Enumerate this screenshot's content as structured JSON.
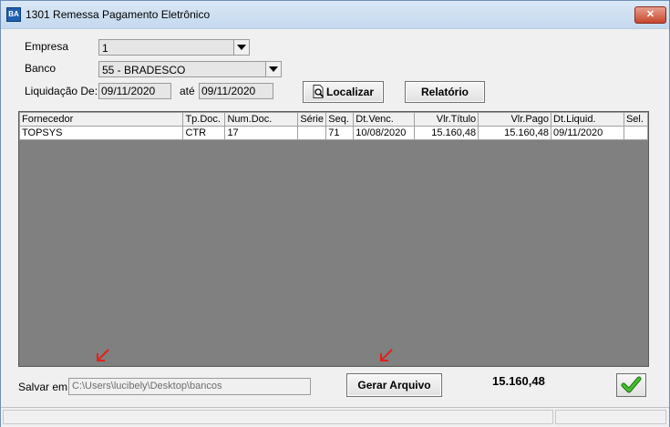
{
  "window": {
    "title": "1301 Remessa Pagamento Eletrônico",
    "icon_label": "BA",
    "close_label": "✕"
  },
  "form": {
    "empresa_label": "Empresa",
    "empresa_value": "1",
    "banco_label": "Banco",
    "banco_value": "55 - BRADESCO",
    "liquidacao_label": "Liquidação De:",
    "liquidacao_from": "09/11/2020",
    "ate_label": "até",
    "liquidacao_to": "09/11/2020",
    "localizar_label": "Localizar",
    "relatorio_label": "Relatório"
  },
  "grid": {
    "columns": [
      "Fornecedor",
      "Tp.Doc.",
      "Num.Doc.",
      "Série",
      "Seq.",
      "Dt.Venc.",
      "Vlr.Título",
      "Vlr.Pago",
      "Dt.Liquid.",
      "Sel."
    ],
    "rows": [
      [
        "TOPSYS",
        "CTR",
        "17",
        "",
        "71",
        "10/08/2020",
        "15.160,48",
        "15.160,48",
        "09/11/2020",
        ""
      ]
    ]
  },
  "footer": {
    "salvar_label": "Salvar em:",
    "salvar_value": "C:\\Users\\lucibely\\Desktop\\bancos",
    "gerar_label": "Gerar Arquivo",
    "total": "15.160,48"
  },
  "colors": {
    "arrow_red": "#e0201a",
    "grid_bg": "#808080",
    "check_green": "#2e9e1e"
  }
}
